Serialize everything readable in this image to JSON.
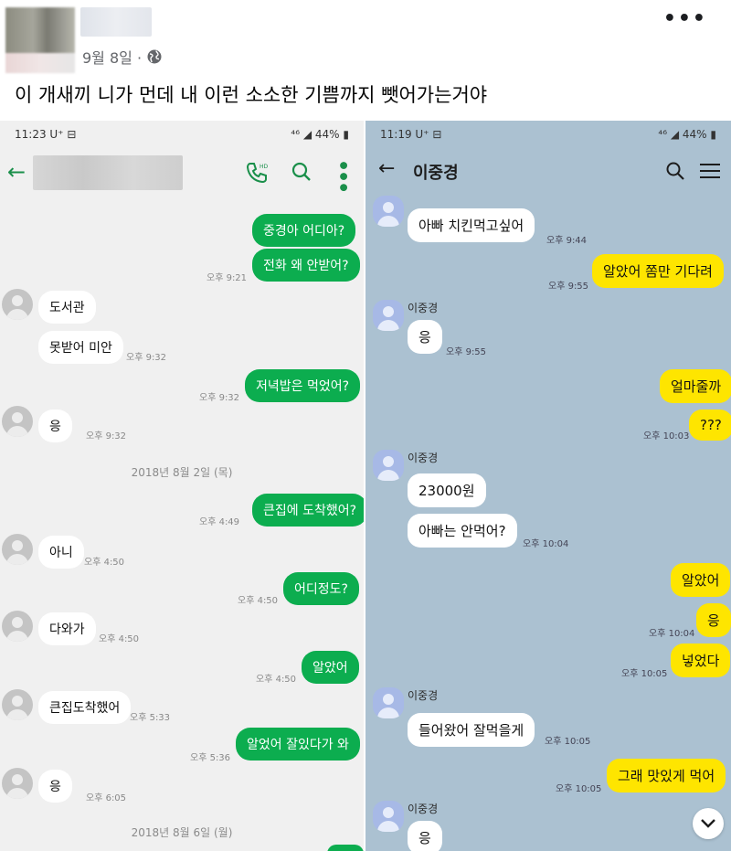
{
  "post": {
    "date": "9월 8일 ·",
    "text": "이 개새끼 니가 먼데 내 이런 소소한 기쁨까지 뺏어가는거야",
    "more_icon": "more-horizontal-icon",
    "privacy_icon": "globe-icon"
  },
  "left_screen": {
    "status_time": "11:23 U⁺ ⊟",
    "status_right": "⁴⁶ ◢ 44% ▮",
    "accent_color": "#0cad4f",
    "date_separator_1": "2018년 8월 2일 (목)",
    "date_separator_2": "2018년 8월 6일 (월)",
    "messages": [
      {
        "dir": "out",
        "text": "중경아 어디아?"
      },
      {
        "dir": "out",
        "text": "전화 왜 안받어?",
        "time": "오후 9:21"
      },
      {
        "dir": "in",
        "text": "도서관"
      },
      {
        "dir": "in",
        "text": "못받어 미안",
        "time": "오후 9:32"
      },
      {
        "dir": "out",
        "text": "저녁밥은 먹었어?",
        "time": "오후 9:32"
      },
      {
        "dir": "in",
        "text": "응",
        "time": "오후 9:32"
      },
      {
        "dir": "out",
        "text": "큰집에 도착했어?",
        "time": "오후 4:49"
      },
      {
        "dir": "in",
        "text": "아니",
        "time": "오후 4:50"
      },
      {
        "dir": "out",
        "text": "어디정도?",
        "time": "오후 4:50"
      },
      {
        "dir": "in",
        "text": "다와가",
        "time": "오후 4:50"
      },
      {
        "dir": "out",
        "text": "알았어",
        "time": "오후 4:50"
      },
      {
        "dir": "in",
        "text": "큰집도착했어",
        "time": "오후 5:33"
      },
      {
        "dir": "out",
        "text": "알었어 잘있다가 와",
        "time": "오후 5:36"
      },
      {
        "dir": "in",
        "text": "응",
        "time": "오후 6:05"
      }
    ]
  },
  "right_screen": {
    "status_time": "11:19 U⁺ ⊟",
    "status_right": "⁴⁶ ◢ 44% ▮",
    "title": "이중경",
    "bg_color": "#abc1d1",
    "bubble_color": "#fee500",
    "sender_name": "이중경",
    "messages": [
      {
        "dir": "in",
        "text": "아빠 치킨먹고싶어",
        "time": "오후 9:44"
      },
      {
        "dir": "out",
        "text": "알았어 쫌만 기다려",
        "time": "오후 9:55"
      },
      {
        "dir": "in",
        "text": "응",
        "time": "오후 9:55"
      },
      {
        "dir": "out",
        "text": "얼마줄까"
      },
      {
        "dir": "out",
        "text": "???",
        "time": "오후 10:03"
      },
      {
        "dir": "in",
        "text": "23000원"
      },
      {
        "dir": "in",
        "text": "아빠는 안먹어?",
        "time": "오후 10:04"
      },
      {
        "dir": "out",
        "text": "알았어"
      },
      {
        "dir": "out",
        "text": "응",
        "time": "오후 10:04"
      },
      {
        "dir": "out",
        "text": "넣었다",
        "time": "오후 10:05"
      },
      {
        "dir": "in",
        "text": "들어왔어 잘먹을게",
        "time": "오후 10:05"
      },
      {
        "dir": "out",
        "text": "그래 맛있게 먹어",
        "time": "오후 10:05"
      },
      {
        "dir": "in",
        "text": "응"
      }
    ]
  }
}
